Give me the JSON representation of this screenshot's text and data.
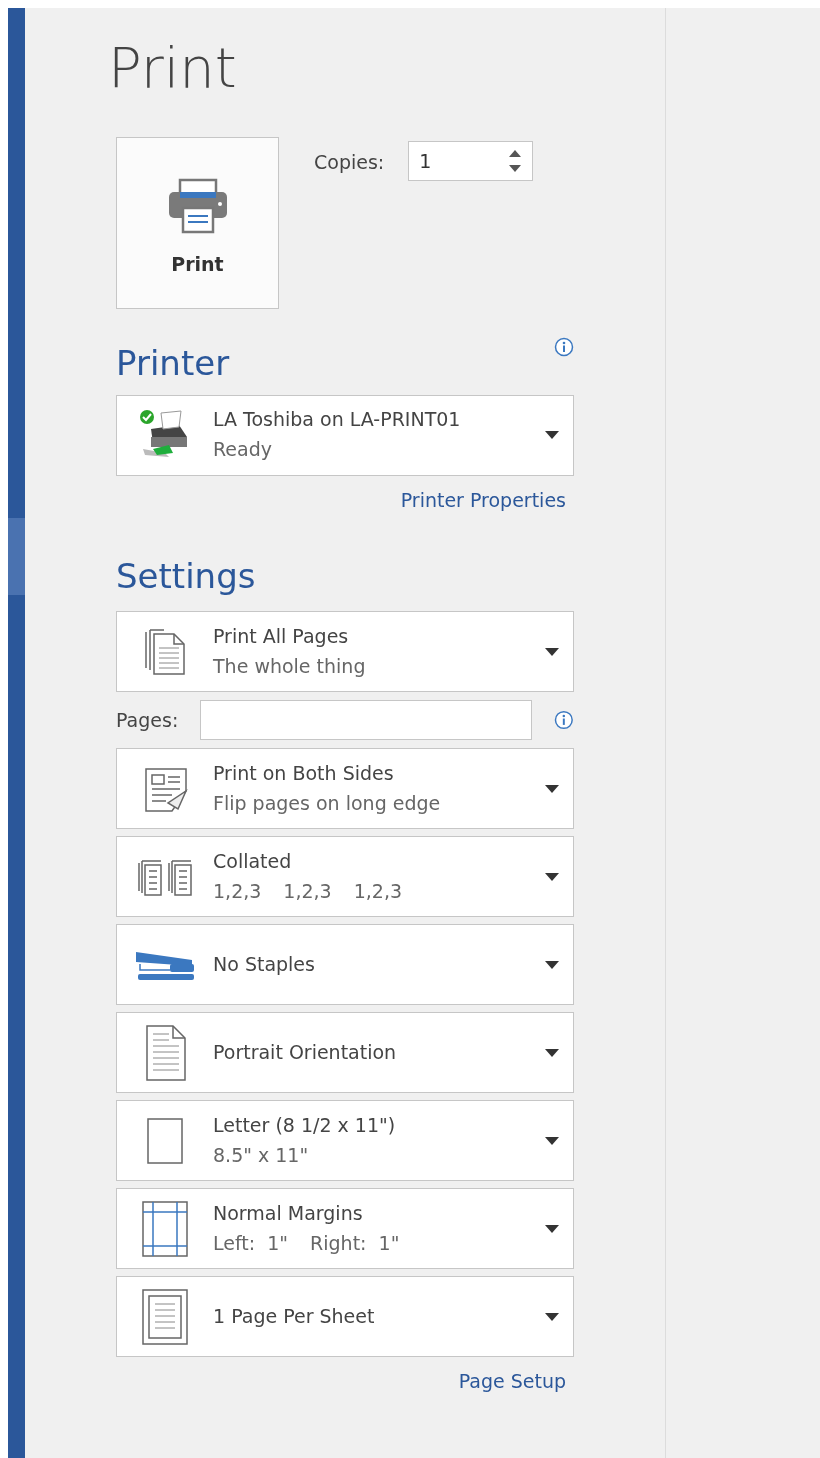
{
  "title": "Print",
  "print_button": {
    "label": "Print"
  },
  "copies": {
    "label": "Copies:",
    "value": "1"
  },
  "printer": {
    "heading": "Printer",
    "name": "LA Toshiba on LA-PRINT01",
    "status": "Ready",
    "ready": true,
    "properties_link": "Printer Properties"
  },
  "settings": {
    "heading": "Settings",
    "pages_field": {
      "label": "Pages:"
    },
    "items": [
      {
        "kind": "pages",
        "title": "Print All Pages",
        "subtitle": [
          "The whole thing"
        ]
      },
      {
        "kind": "duplex",
        "title": "Print on Both Sides",
        "subtitle": [
          "Flip pages on long edge"
        ]
      },
      {
        "kind": "collate",
        "title": "Collated",
        "subtitle": [
          "1,2,3",
          "1,2,3",
          "1,2,3"
        ]
      },
      {
        "kind": "staple",
        "title": "No Staples"
      },
      {
        "kind": "orientation",
        "title": "Portrait Orientation"
      },
      {
        "kind": "paper",
        "title": "Letter (8 1/2 x 11\")",
        "subtitle": [
          "8.5\" x 11\""
        ]
      },
      {
        "kind": "margins",
        "title": "Normal Margins",
        "subtitle": [
          "Left:  1\"",
          "Right:  1\""
        ]
      },
      {
        "kind": "persheet",
        "title": "1 Page Per Sheet"
      }
    ],
    "page_setup_link": "Page Setup"
  }
}
